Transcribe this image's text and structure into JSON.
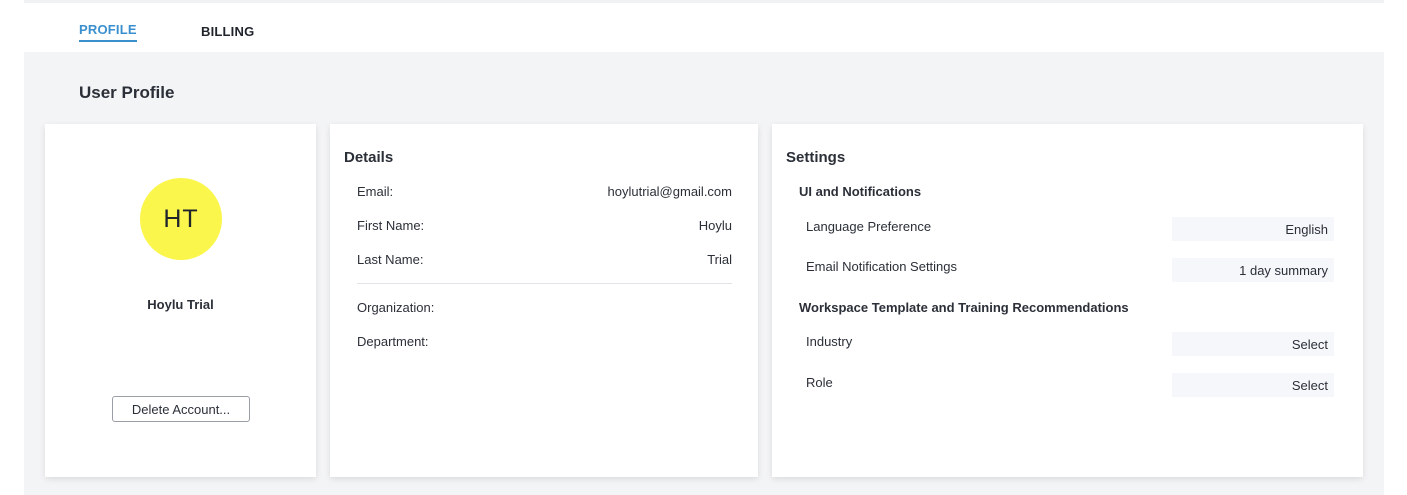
{
  "tabs": [
    {
      "label": "PROFILE",
      "active": true
    },
    {
      "label": "BILLING",
      "active": false
    }
  ],
  "page": {
    "section_title": "User Profile"
  },
  "profile": {
    "initials": "HT",
    "avatar_color": "#fbf64b",
    "name": "Hoylu Trial",
    "delete_label": "Delete Account..."
  },
  "details": {
    "heading": "Details",
    "rows": [
      {
        "label": "Email:",
        "value": "hoylutrial@gmail.com"
      },
      {
        "label": "First Name:",
        "value": "Hoylu"
      },
      {
        "label": "Last Name:",
        "value": "Trial"
      },
      {
        "label": "Organization:",
        "value": ""
      },
      {
        "label": "Department:",
        "value": ""
      }
    ]
  },
  "settings": {
    "heading": "Settings",
    "ui_heading": "UI and Notifications",
    "language": {
      "label": "Language Preference",
      "value": "English"
    },
    "email_notifications": {
      "label": "Email Notification Settings",
      "value": "1 day summary"
    },
    "workspace_heading": "Workspace Template and Training Recommendations",
    "industry": {
      "label": "Industry",
      "value": "Select"
    },
    "role": {
      "label": "Role",
      "value": "Select"
    }
  },
  "colors": {
    "accent": "#3a8fcf",
    "panel_bg": "#f3f4f6"
  }
}
